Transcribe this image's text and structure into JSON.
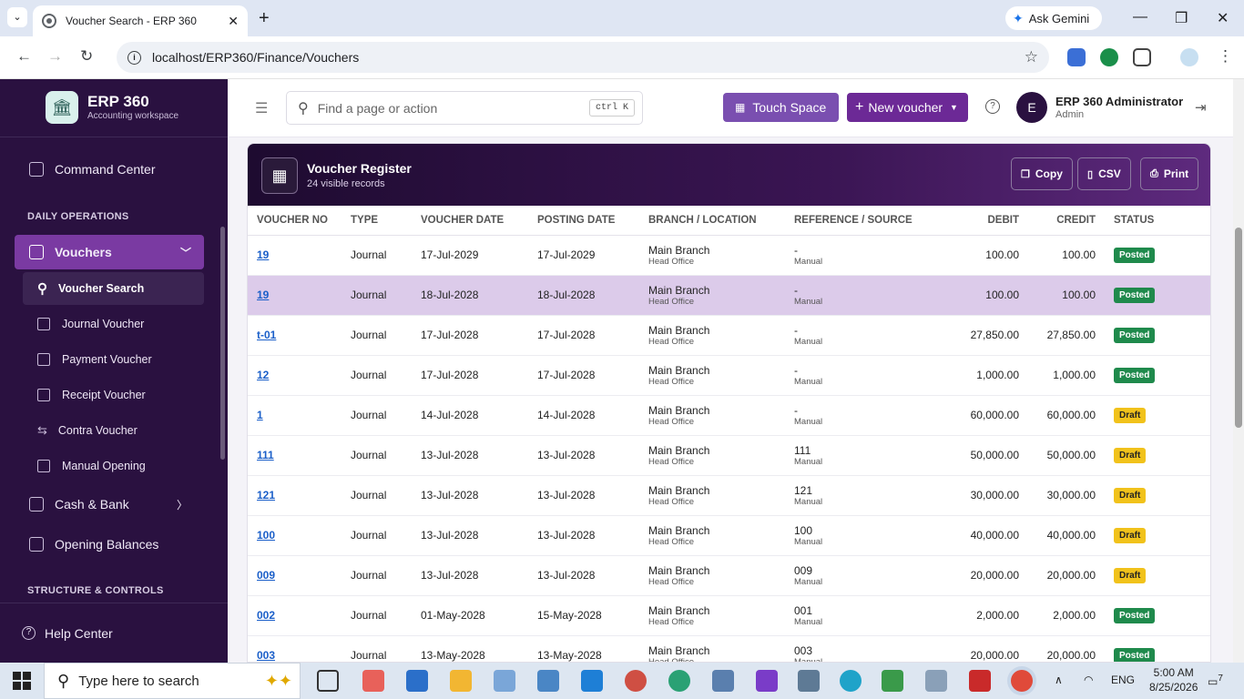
{
  "browser": {
    "tab_title": "Voucher Search - ERP 360",
    "url": "localhost/ERP360/Finance/Vouchers",
    "ask_gemini": "Ask Gemini"
  },
  "sidebar": {
    "brand_title": "ERP 360",
    "brand_subtitle": "Accounting workspace",
    "command_center": "Command Center",
    "section_daily": "DAILY OPERATIONS",
    "vouchers": "Vouchers",
    "sub_items": [
      "Voucher Search",
      "Journal Voucher",
      "Payment Voucher",
      "Receipt Voucher",
      "Contra Voucher",
      "Manual Opening"
    ],
    "cash_bank": "Cash & Bank",
    "opening_balances": "Opening Balances",
    "section_structure": "STRUCTURE & CONTROLS",
    "help_center": "Help Center"
  },
  "topbar": {
    "search_placeholder": "Find a page or action",
    "shortcut": "ctrl K",
    "touch_space": "Touch Space",
    "new_voucher": "New voucher",
    "avatar_initial": "E",
    "user_name": "ERP 360 Administrator",
    "user_role": "Admin"
  },
  "register": {
    "title": "Voucher Register",
    "count": "24 visible records",
    "copy": "Copy",
    "csv": "CSV",
    "print": "Print",
    "columns": [
      "VOUCHER NO",
      "TYPE",
      "VOUCHER DATE",
      "POSTING DATE",
      "BRANCH / LOCATION",
      "REFERENCE / SOURCE",
      "DEBIT",
      "CREDIT",
      "STATUS"
    ],
    "rows": [
      {
        "no": "19",
        "type": "Journal",
        "vdate": "17-Jul-2029",
        "pdate": "17-Jul-2029",
        "branch": "Main Branch",
        "loc": "Head Office",
        "ref": "-",
        "src": "Manual",
        "debit": "100.00",
        "credit": "100.00",
        "status": "Posted"
      },
      {
        "no": "19",
        "type": "Journal",
        "vdate": "18-Jul-2028",
        "pdate": "18-Jul-2028",
        "branch": "Main Branch",
        "loc": "Head Office",
        "ref": "-",
        "src": "Manual",
        "debit": "100.00",
        "credit": "100.00",
        "status": "Posted"
      },
      {
        "no": "t-01",
        "type": "Journal",
        "vdate": "17-Jul-2028",
        "pdate": "17-Jul-2028",
        "branch": "Main Branch",
        "loc": "Head Office",
        "ref": "-",
        "src": "Manual",
        "debit": "27,850.00",
        "credit": "27,850.00",
        "status": "Posted"
      },
      {
        "no": "12",
        "type": "Journal",
        "vdate": "17-Jul-2028",
        "pdate": "17-Jul-2028",
        "branch": "Main Branch",
        "loc": "Head Office",
        "ref": "-",
        "src": "Manual",
        "debit": "1,000.00",
        "credit": "1,000.00",
        "status": "Posted"
      },
      {
        "no": "1",
        "type": "Journal",
        "vdate": "14-Jul-2028",
        "pdate": "14-Jul-2028",
        "branch": "Main Branch",
        "loc": "Head Office",
        "ref": "-",
        "src": "Manual",
        "debit": "60,000.00",
        "credit": "60,000.00",
        "status": "Draft"
      },
      {
        "no": "111",
        "type": "Journal",
        "vdate": "13-Jul-2028",
        "pdate": "13-Jul-2028",
        "branch": "Main Branch",
        "loc": "Head Office",
        "ref": "111",
        "src": "Manual",
        "debit": "50,000.00",
        "credit": "50,000.00",
        "status": "Draft"
      },
      {
        "no": "121",
        "type": "Journal",
        "vdate": "13-Jul-2028",
        "pdate": "13-Jul-2028",
        "branch": "Main Branch",
        "loc": "Head Office",
        "ref": "121",
        "src": "Manual",
        "debit": "30,000.00",
        "credit": "30,000.00",
        "status": "Draft"
      },
      {
        "no": "100",
        "type": "Journal",
        "vdate": "13-Jul-2028",
        "pdate": "13-Jul-2028",
        "branch": "Main Branch",
        "loc": "Head Office",
        "ref": "100",
        "src": "Manual",
        "debit": "40,000.00",
        "credit": "40,000.00",
        "status": "Draft"
      },
      {
        "no": "009",
        "type": "Journal",
        "vdate": "13-Jul-2028",
        "pdate": "13-Jul-2028",
        "branch": "Main Branch",
        "loc": "Head Office",
        "ref": "009",
        "src": "Manual",
        "debit": "20,000.00",
        "credit": "20,000.00",
        "status": "Draft"
      },
      {
        "no": "002",
        "type": "Journal",
        "vdate": "01-May-2028",
        "pdate": "15-May-2028",
        "branch": "Main Branch",
        "loc": "Head Office",
        "ref": "001",
        "src": "Manual",
        "debit": "2,000.00",
        "credit": "2,000.00",
        "status": "Posted"
      },
      {
        "no": "003",
        "type": "Journal",
        "vdate": "13-May-2028",
        "pdate": "13-May-2028",
        "branch": "Main Branch",
        "loc": "Head Office",
        "ref": "003",
        "src": "Manual",
        "debit": "20,000.00",
        "credit": "20,000.00",
        "status": "Posted"
      }
    ]
  },
  "taskbar": {
    "search_placeholder": "Type here to search",
    "lang": "ENG",
    "time": "5:00 AM",
    "date": "8/25/2026",
    "notif_count": "7"
  }
}
